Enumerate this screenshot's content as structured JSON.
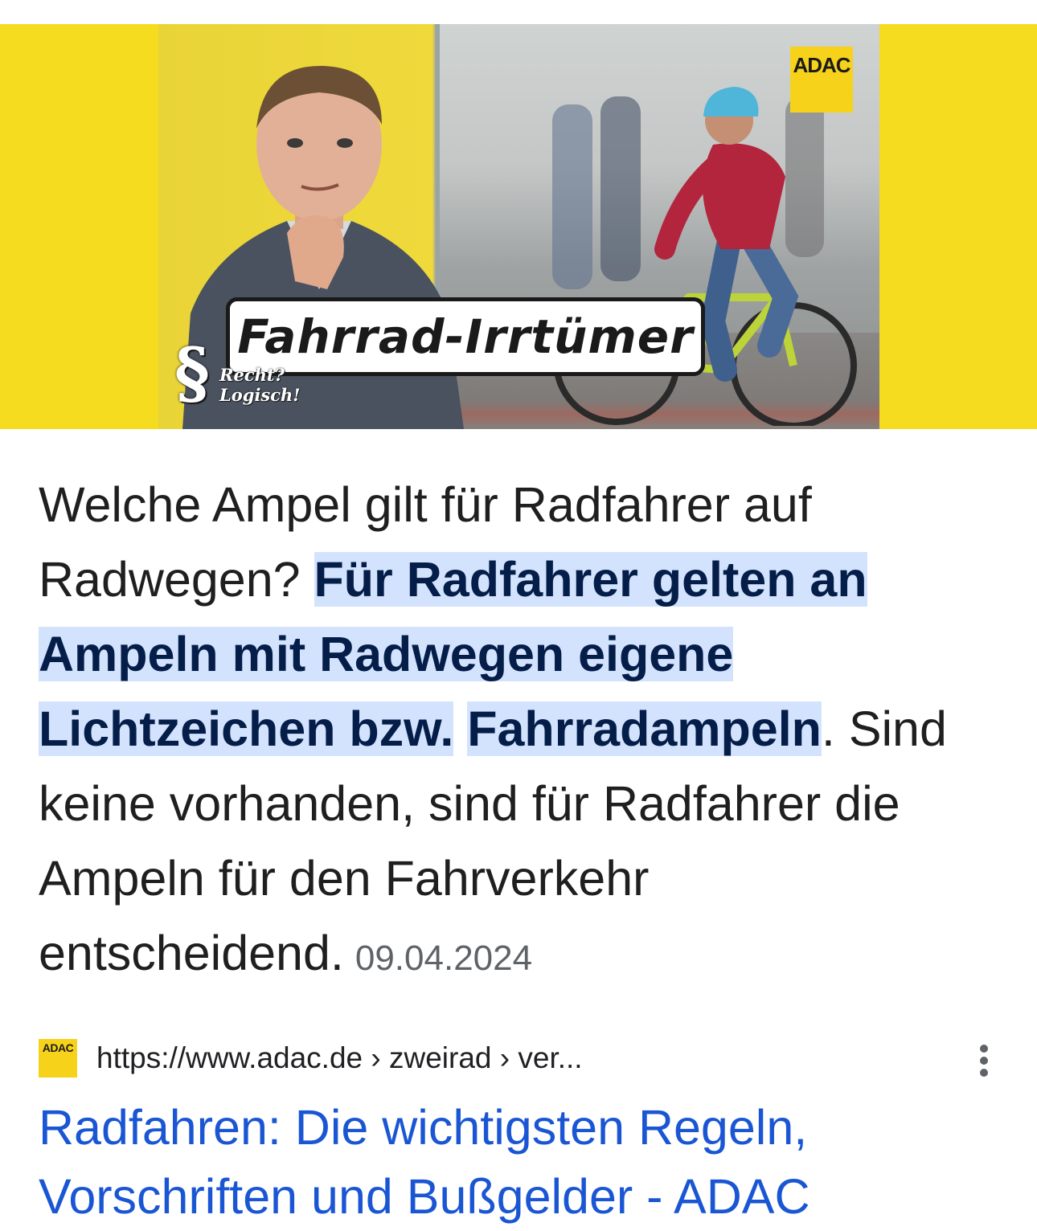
{
  "hero": {
    "brand_badge": "ADAC",
    "title": "Fahrrad-Irrtümer",
    "section_symbol": "§",
    "section_line1": "Recht?",
    "section_line2": "Logisch!"
  },
  "answer": {
    "intro": "Welche Ampel gilt für Radfahrer auf Radwegen? ",
    "highlight1": "Für Radfahrer gelten an Ampeln mit Radwegen eigene Lichtzeichen bzw.",
    "space": " ",
    "highlight2": "Fahrradampeln",
    "rest": ". Sind keine vorhanden, sind für Radfahrer die Ampeln für den Fahrverkehr entscheidend.",
    "date": "09.04.2024"
  },
  "source": {
    "favicon_text": "ADAC",
    "url": "https://www.adac.de › zweirad › ver..."
  },
  "result": {
    "title": "Radfahren: Die wichtigsten Regeln, Vorschriften und Bußgelder - ADAC"
  },
  "icons": {
    "more": "more-vert-icon"
  },
  "colors": {
    "highlight_bg": "#d3e3fd",
    "link": "#1a56d4",
    "adac_yellow": "#f7d21b"
  }
}
